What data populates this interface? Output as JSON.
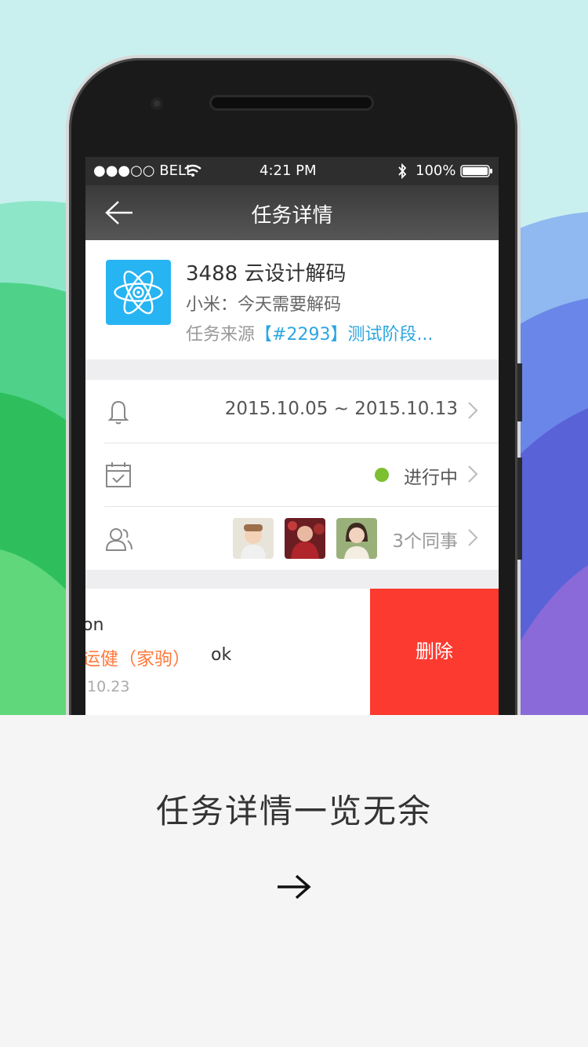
{
  "status_bar": {
    "carrier": "●●●○○ BELL",
    "time": "4:21 PM",
    "battery": "100%",
    "icons": [
      "wifi-icon",
      "bluetooth-icon",
      "battery-icon"
    ]
  },
  "nav": {
    "title": "任务详情",
    "back_icon": "back-arrow-icon"
  },
  "task": {
    "icon": "atom-icon",
    "title": "3488  云设计解码",
    "subtitle": "小米：今天需要解码",
    "source_prefix": "任务来源",
    "source_link": "【#2293】测试阶段..."
  },
  "details": {
    "date_range": "2015.10.05 ~ 2015.10.13",
    "status": "进行中",
    "status_color": "#7cbf2f",
    "colleagues": "3个同事"
  },
  "comment": {
    "name": "on",
    "user": "运健（家驹）",
    "text": "ok",
    "date": ".10.23",
    "delete_label": "删除"
  },
  "footer": {
    "caption": "任务详情一览无余",
    "arrow": "→"
  },
  "colors": {
    "delete_red": "#fc3a2f",
    "link_blue": "#2ca6e0",
    "user_orange": "#ff7a3c",
    "app_icon_blue": "#27b4f2"
  }
}
